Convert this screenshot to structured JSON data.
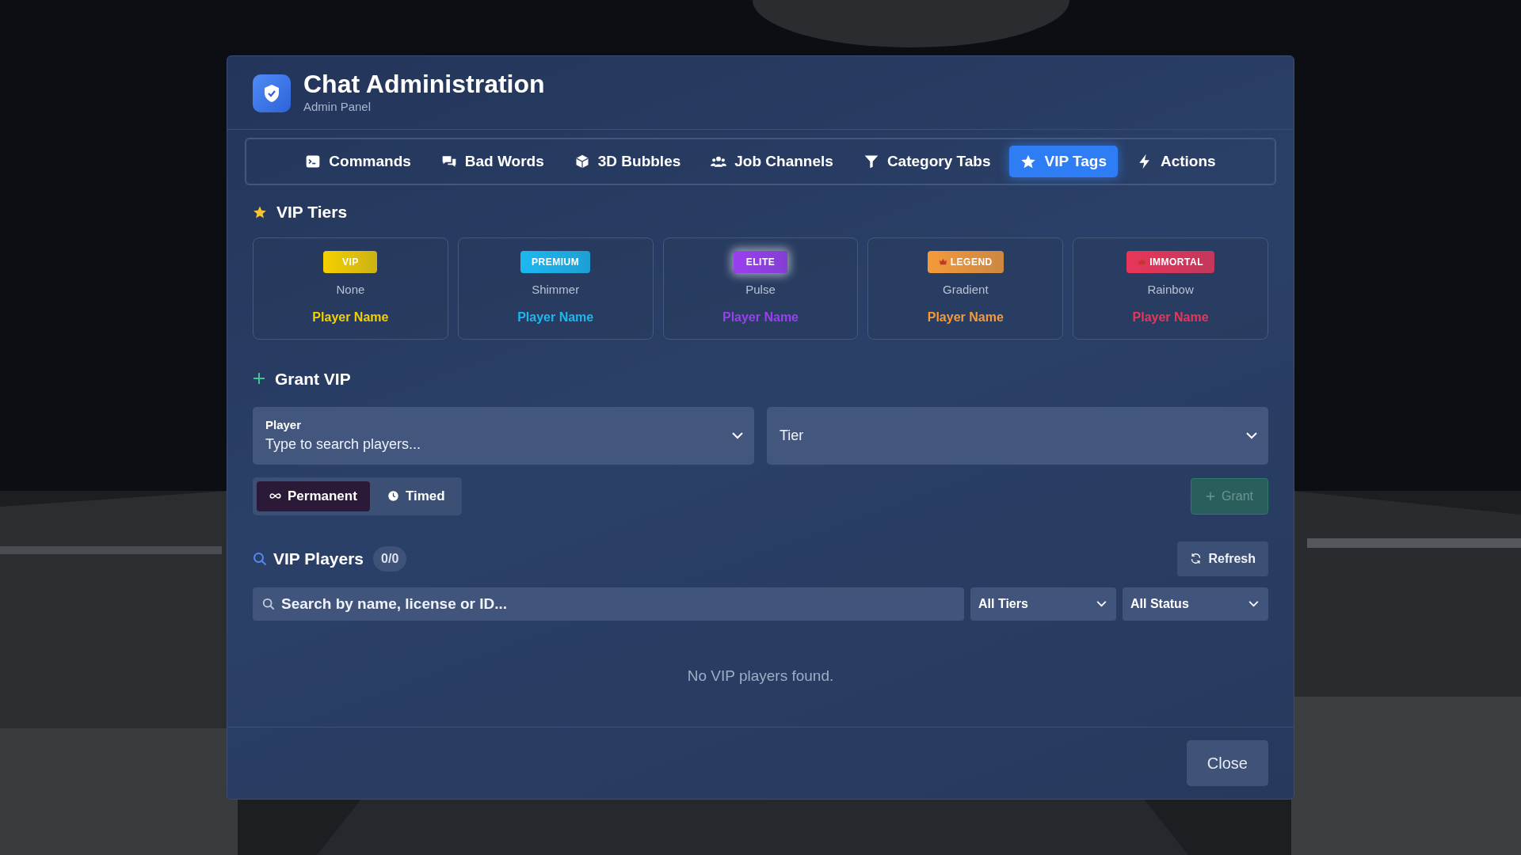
{
  "window": {
    "title": "Chat Administration",
    "subtitle": "Admin Panel"
  },
  "tabs": [
    {
      "label": "Commands",
      "selected": false
    },
    {
      "label": "Bad Words",
      "selected": false
    },
    {
      "label": "3D Bubbles",
      "selected": false
    },
    {
      "label": "Job Channels",
      "selected": false
    },
    {
      "label": "Category Tabs",
      "selected": false
    },
    {
      "label": "VIP Tags",
      "selected": true
    },
    {
      "label": "Actions",
      "selected": false
    }
  ],
  "tiers": {
    "title": "VIP Tiers",
    "items": [
      {
        "badge": "VIP",
        "effect": "None",
        "sample": "Player Name",
        "color": "#f5d000",
        "crown": false,
        "glow": false
      },
      {
        "badge": "PREMIUM",
        "effect": "Shimmer",
        "sample": "Player Name",
        "color": "#1cb8f0",
        "crown": false,
        "glow": false
      },
      {
        "badge": "ELITE",
        "effect": "Pulse",
        "sample": "Player Name",
        "color": "#9b3ff0",
        "crown": false,
        "glow": true
      },
      {
        "badge": "LEGEND",
        "effect": "Gradient",
        "sample": "Player Name",
        "color": "#f59a3a",
        "crown": true,
        "glow": false
      },
      {
        "badge": "IMMORTAL",
        "effect": "Rainbow",
        "sample": "Player Name",
        "color": "#e8365a",
        "crown": true,
        "glow": false
      }
    ]
  },
  "grant": {
    "title": "Grant VIP",
    "player": {
      "label": "Player",
      "placeholder": "Type to search players..."
    },
    "tier": {
      "placeholder": "Tier"
    },
    "durations": [
      {
        "label": "Permanent",
        "selected": true
      },
      {
        "label": "Timed",
        "selected": false
      }
    ],
    "button": {
      "label": "Grant",
      "disabled": true
    }
  },
  "players": {
    "title": "VIP Players",
    "count": "0/0",
    "refresh": "Refresh",
    "search": {
      "placeholder": "Search by name, license or ID..."
    },
    "filters": [
      "All Tiers",
      "All Status"
    ],
    "empty": "No VIP players found."
  },
  "footer": {
    "close": "Close"
  }
}
